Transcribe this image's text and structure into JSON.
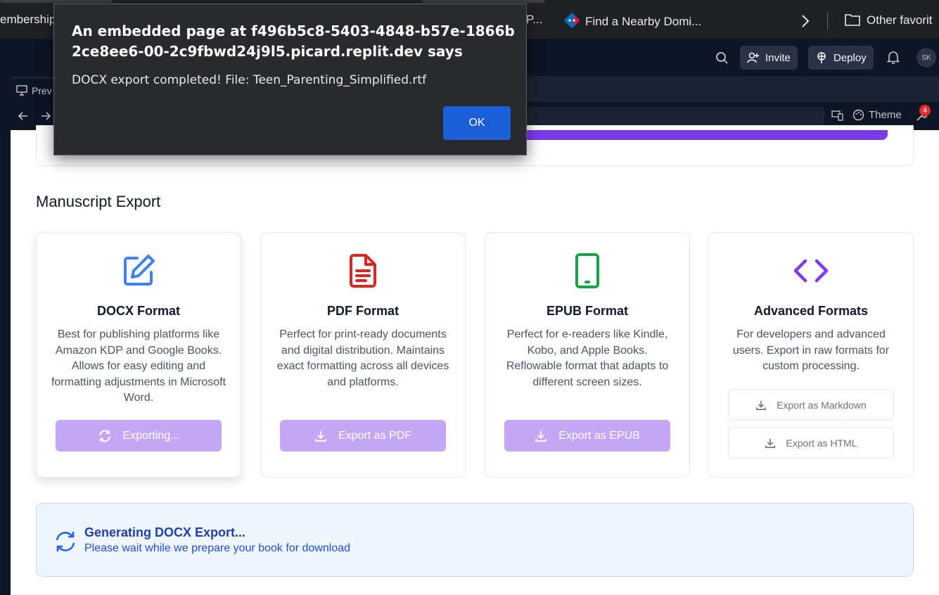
{
  "bookmarks": {
    "left_label": "embership",
    "ellipsis_label": "P...",
    "dominos_label": "Find a Nearby Domi...",
    "other_favorites_label": "Other favorit"
  },
  "replit": {
    "invite_label": "Invite",
    "deploy_label": "Deploy",
    "avatar_initials": "SK"
  },
  "webview": {
    "preview_tab_label": "Prev",
    "theme_label": "Theme",
    "notification_count": "4"
  },
  "dialog": {
    "title": "An embedded page at f496b5c8-5403-4848-b57e-1866b2ce8ee6-00-2c9fbwd24j9l5.picard.replit.dev says",
    "message": "DOCX export completed! File: Teen_Parenting_Simplified.rtf",
    "ok_label": "OK"
  },
  "export": {
    "section_title": "Manuscript Export",
    "cards": [
      {
        "title": "DOCX Format",
        "description": "Best for publishing platforms like Amazon KDP and Google Books. Allows for easy editing and formatting adjustments in Microsoft Word.",
        "button_label": "Exporting...",
        "icon": "edit-icon",
        "icon_color": "#3b82f6"
      },
      {
        "title": "PDF Format",
        "description": "Perfect for print-ready documents and digital distribution. Maintains exact formatting across all devices and platforms.",
        "button_label": "Export as PDF",
        "icon": "file-text-icon",
        "icon_color": "#dc2626"
      },
      {
        "title": "EPUB Format",
        "description": "Perfect for e-readers like Kindle, Kobo, and Apple Books. Reflowable format that adapts to different screen sizes.",
        "button_label": "Export as EPUB",
        "icon": "tablet-icon",
        "icon_color": "#16a34a"
      },
      {
        "title": "Advanced Formats",
        "description": "For developers and advanced users. Export in raw formats for custom processing.",
        "markdown_label": "Export as Markdown",
        "html_label": "Export as HTML",
        "icon": "code-icon",
        "icon_color": "#7c3aed"
      }
    ],
    "button_color": "#c4a8f5"
  },
  "status": {
    "title": "Generating DOCX Export...",
    "subtitle": "Please wait while we prepare your book for download"
  }
}
